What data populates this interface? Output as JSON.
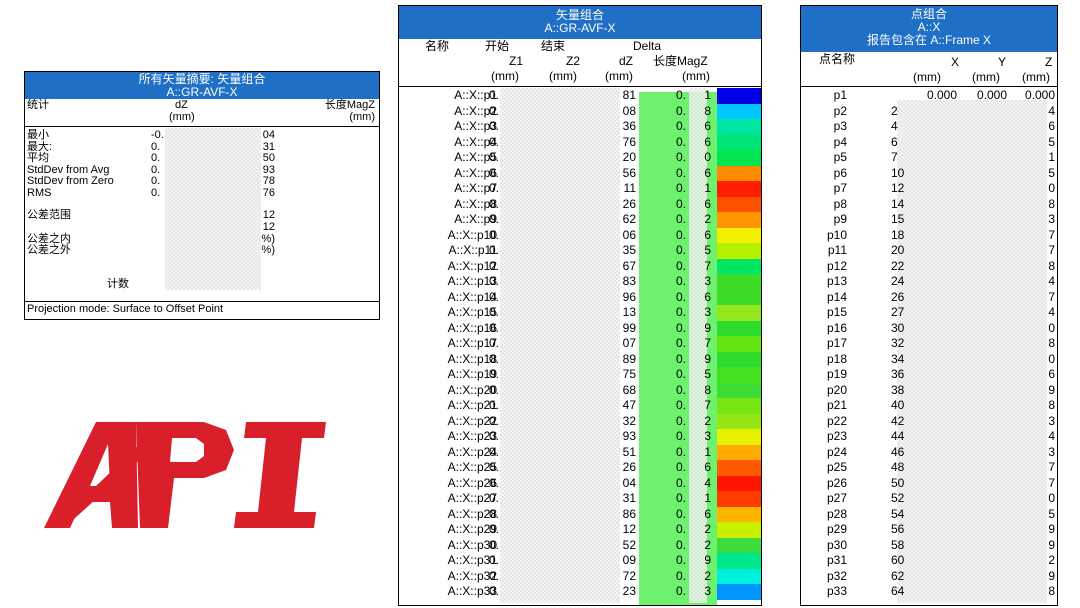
{
  "summary": {
    "title_line1": "所有矢量摘要: 矢量组合",
    "title_line2": "A::GR-AVF-X",
    "col_stat": "统计",
    "col_dz": "dZ",
    "col_mag": "长度MagZ",
    "unit_dz": "(mm)",
    "unit_mag": "(mm)",
    "rows": [
      {
        "label": "最小",
        "dz": "-0.",
        "mag": "04"
      },
      {
        "label": "最大:",
        "dz": "0.",
        "mag": "31"
      },
      {
        "label": "平均",
        "dz": "0.",
        "mag": "50"
      },
      {
        "label": "StdDev from Avg",
        "dz": "0.",
        "mag": "93"
      },
      {
        "label": "StdDev from Zero",
        "dz": "0.",
        "mag": "78"
      },
      {
        "label": "RMS",
        "dz": "0.",
        "mag": "76"
      },
      {
        "label": "公差范围",
        "dz": "",
        "mag": "12"
      },
      {
        "label": "",
        "dz": "",
        "mag": "12"
      },
      {
        "label": "公差之内",
        "dz": "",
        "mag": "%)"
      },
      {
        "label": "公差之外",
        "dz": "",
        "mag": "%)"
      }
    ],
    "count_label": "计数",
    "footer": "Projection mode: Surface to Offset Point"
  },
  "logo": {
    "text": "API",
    "color": "#d9202a"
  },
  "vectors": {
    "title_line1": "矢量组合",
    "title_line2": "A::GR-AVF-X",
    "h_name": "名称",
    "h_start": "开始",
    "h_end": "结束",
    "h_delta": "Delta",
    "h_z1": "Z1",
    "h_z2": "Z2",
    "h_dz": "dZ",
    "h_mag": "长度MagZ",
    "u_z1": "(mm)",
    "u_z2": "(mm)",
    "u_dz": "(mm)",
    "u_mag": "(mm)",
    "rows": [
      {
        "name": "A::X::p1",
        "z1": "0.",
        "dz": "81",
        "mag_a": "0.",
        "mag_b": "1",
        "color": "#0000e6"
      },
      {
        "name": "A::X::p2",
        "z1": "0.",
        "dz": "08",
        "mag_a": "0.",
        "mag_b": "8",
        "color": "#00c8ff"
      },
      {
        "name": "A::X::p3",
        "z1": "0.",
        "dz": "36",
        "mag_a": "0.",
        "mag_b": "6",
        "color": "#00e6a0"
      },
      {
        "name": "A::X::p4",
        "z1": "0.",
        "dz": "76",
        "mag_a": "0.",
        "mag_b": "6",
        "color": "#00e676"
      },
      {
        "name": "A::X::p5",
        "z1": "0.",
        "dz": "20",
        "mag_a": "0.",
        "mag_b": "0",
        "color": "#00e650"
      },
      {
        "name": "A::X::p6",
        "z1": "0.",
        "dz": "56",
        "mag_a": "0.",
        "mag_b": "6",
        "color": "#ff8c00"
      },
      {
        "name": "A::X::p7",
        "z1": "0.",
        "dz": "11",
        "mag_a": "0.",
        "mag_b": "1",
        "color": "#ff1e00"
      },
      {
        "name": "A::X::p8",
        "z1": "0.",
        "dz": "26",
        "mag_a": "0.",
        "mag_b": "6",
        "color": "#ff5000"
      },
      {
        "name": "A::X::p9",
        "z1": "0.",
        "dz": "62",
        "mag_a": "0.",
        "mag_b": "2",
        "color": "#ff9600"
      },
      {
        "name": "A::X::p10",
        "z1": "0.",
        "dz": "06",
        "mag_a": "0.",
        "mag_b": "6",
        "color": "#f0f000"
      },
      {
        "name": "A::X::p11",
        "z1": "0.",
        "dz": "35",
        "mag_a": "0.",
        "mag_b": "5",
        "color": "#b4f000"
      },
      {
        "name": "A::X::p12",
        "z1": "0.",
        "dz": "67",
        "mag_a": "0.",
        "mag_b": "7",
        "color": "#00e664"
      },
      {
        "name": "A::X::p13",
        "z1": "0.",
        "dz": "83",
        "mag_a": "0.",
        "mag_b": "3",
        "color": "#3cdc28"
      },
      {
        "name": "A::X::p14",
        "z1": "0.",
        "dz": "96",
        "mag_a": "0.",
        "mag_b": "6",
        "color": "#3cdc28"
      },
      {
        "name": "A::X::p15",
        "z1": "0.",
        "dz": "13",
        "mag_a": "0.",
        "mag_b": "3",
        "color": "#96e61e"
      },
      {
        "name": "A::X::p16",
        "z1": "0.",
        "dz": "99",
        "mag_a": "0.",
        "mag_b": "9",
        "color": "#2ddc2d"
      },
      {
        "name": "A::X::p17",
        "z1": "0.",
        "dz": "07",
        "mag_a": "0.",
        "mag_b": "7",
        "color": "#64e614"
      },
      {
        "name": "A::X::p18",
        "z1": "0.",
        "dz": "89",
        "mag_a": "0.",
        "mag_b": "9",
        "color": "#2ddc2d"
      },
      {
        "name": "A::X::p19",
        "z1": "0.",
        "dz": "75",
        "mag_a": "0.",
        "mag_b": "5",
        "color": "#46e11e"
      },
      {
        "name": "A::X::p20",
        "z1": "0.",
        "dz": "68",
        "mag_a": "0.",
        "mag_b": "8",
        "color": "#3cdc32"
      },
      {
        "name": "A::X::p21",
        "z1": "0.",
        "dz": "47",
        "mag_a": "0.",
        "mag_b": "7",
        "color": "#78e614"
      },
      {
        "name": "A::X::p22",
        "z1": "0.",
        "dz": "32",
        "mag_a": "0.",
        "mag_b": "2",
        "color": "#96e614"
      },
      {
        "name": "A::X::p23",
        "z1": "0.",
        "dz": "93",
        "mag_a": "0.",
        "mag_b": "3",
        "color": "#e6f000"
      },
      {
        "name": "A::X::p24",
        "z1": "0.",
        "dz": "51",
        "mag_a": "0.",
        "mag_b": "1",
        "color": "#ffaa00"
      },
      {
        "name": "A::X::p25",
        "z1": "0.",
        "dz": "26",
        "mag_a": "0.",
        "mag_b": "6",
        "color": "#ff5a00"
      },
      {
        "name": "A::X::p26",
        "z1": "0.",
        "dz": "04",
        "mag_a": "0.",
        "mag_b": "4",
        "color": "#ff1400"
      },
      {
        "name": "A::X::p27",
        "z1": "0.",
        "dz": "31",
        "mag_a": "0.",
        "mag_b": "1",
        "color": "#ff3c00"
      },
      {
        "name": "A::X::p28",
        "z1": "0.",
        "dz": "86",
        "mag_a": "0.",
        "mag_b": "6",
        "color": "#ffb400"
      },
      {
        "name": "A::X::p29",
        "z1": "0.",
        "dz": "12",
        "mag_a": "0.",
        "mag_b": "2",
        "color": "#c8f000"
      },
      {
        "name": "A::X::p30",
        "z1": "0.",
        "dz": "52",
        "mag_a": "0.",
        "mag_b": "2",
        "color": "#3cdc3c"
      },
      {
        "name": "A::X::p31",
        "z1": "0.",
        "dz": "09",
        "mag_a": "0.",
        "mag_b": "9",
        "color": "#00e68c"
      },
      {
        "name": "A::X::p32",
        "z1": "0.",
        "dz": "72",
        "mag_a": "0.",
        "mag_b": "2",
        "color": "#00f0dc"
      },
      {
        "name": "A::X::p33",
        "z1": "0.",
        "dz": "23",
        "mag_a": "0.",
        "mag_b": "3",
        "color": "#0096ff"
      }
    ]
  },
  "points": {
    "title_line1": "点组合",
    "title_line2": "A::X",
    "title_line3": "报告包含在 A::Frame X",
    "h_name": "点名称",
    "h_x": "X",
    "h_y": "Y",
    "h_z": "Z",
    "u_x": "(mm)",
    "u_y": "(mm)",
    "u_z": "(mm)",
    "first_row": {
      "name": "p1",
      "x": "0.000",
      "y": "0.000",
      "z": "0.000"
    },
    "rows": [
      {
        "name": "p2",
        "x": "2",
        "z": "4"
      },
      {
        "name": "p3",
        "x": "4",
        "z": "6"
      },
      {
        "name": "p4",
        "x": "6",
        "z": "5"
      },
      {
        "name": "p5",
        "x": "7",
        "z": "1"
      },
      {
        "name": "p6",
        "x": "10",
        "z": "5"
      },
      {
        "name": "p7",
        "x": "12",
        "z": "0"
      },
      {
        "name": "p8",
        "x": "14",
        "z": "8"
      },
      {
        "name": "p9",
        "x": "15",
        "z": "3"
      },
      {
        "name": "p10",
        "x": "18",
        "z": "7"
      },
      {
        "name": "p11",
        "x": "20",
        "z": "7"
      },
      {
        "name": "p12",
        "x": "22",
        "z": "8"
      },
      {
        "name": "p13",
        "x": "24",
        "z": "4"
      },
      {
        "name": "p14",
        "x": "26",
        "z": "7"
      },
      {
        "name": "p15",
        "x": "27",
        "z": "4"
      },
      {
        "name": "p16",
        "x": "30",
        "z": "0"
      },
      {
        "name": "p17",
        "x": "32",
        "z": "8"
      },
      {
        "name": "p18",
        "x": "34",
        "z": "0"
      },
      {
        "name": "p19",
        "x": "36",
        "z": "6"
      },
      {
        "name": "p20",
        "x": "38",
        "z": "9"
      },
      {
        "name": "p21",
        "x": "40",
        "z": "8"
      },
      {
        "name": "p22",
        "x": "42",
        "z": "3"
      },
      {
        "name": "p23",
        "x": "44",
        "z": "4"
      },
      {
        "name": "p24",
        "x": "46",
        "z": "3"
      },
      {
        "name": "p25",
        "x": "48",
        "z": "7"
      },
      {
        "name": "p26",
        "x": "50",
        "z": "7"
      },
      {
        "name": "p27",
        "x": "52",
        "z": "0"
      },
      {
        "name": "p28",
        "x": "54",
        "z": "5"
      },
      {
        "name": "p29",
        "x": "56",
        "z": "9"
      },
      {
        "name": "p30",
        "x": "58",
        "z": "9"
      },
      {
        "name": "p31",
        "x": "60",
        "z": "2"
      },
      {
        "name": "p32",
        "x": "62",
        "z": "9"
      },
      {
        "name": "p33",
        "x": "64",
        "z": "8"
      }
    ]
  }
}
